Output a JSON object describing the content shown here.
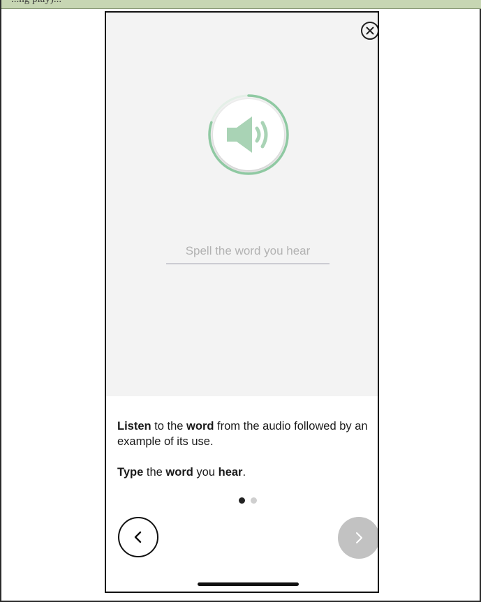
{
  "header_strip": {
    "text": "...ng play)..."
  },
  "exercise": {
    "answer_placeholder": "Spell the word you hear",
    "answer_value": ""
  },
  "instructions": {
    "line1": [
      {
        "text": "Listen",
        "bold": true
      },
      {
        "text": " to the ",
        "bold": false
      },
      {
        "text": "word",
        "bold": true
      },
      {
        "text": " from the audio followed by an example of its use.",
        "bold": false
      }
    ],
    "line2": [
      {
        "text": "Type",
        "bold": true
      },
      {
        "text": " the ",
        "bold": false
      },
      {
        "text": "word",
        "bold": true
      },
      {
        "text": " you ",
        "bold": false
      },
      {
        "text": "hear",
        "bold": true
      },
      {
        "text": ".",
        "bold": false
      }
    ]
  },
  "pagination": {
    "current": 1,
    "total": 2
  },
  "audio": {
    "progress": 0.8
  },
  "icons": {
    "close": "close-circle-icon",
    "speaker": "speaker-icon",
    "back": "chevron-left-icon",
    "next": "chevron-right-icon"
  },
  "colors": {
    "accent": "#8fc9a2",
    "speaker": "#a9d3b5",
    "next_disabled": "#c2c2c2",
    "panel_bg": "#f3f3f3"
  }
}
